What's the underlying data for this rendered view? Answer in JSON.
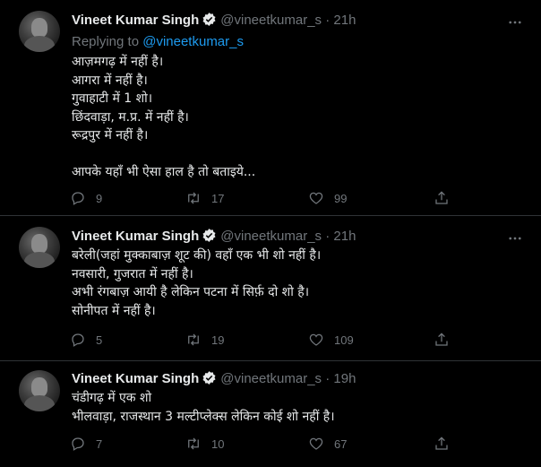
{
  "tweets": [
    {
      "name": "Vineet Kumar Singh",
      "handle": "@vineetkumar_s",
      "dot": "·",
      "time": "21h",
      "replying_prefix": "Replying to ",
      "replying_handle": "@vineetkumar_s",
      "lines": [
        "आज़मगढ़ में नहीं है।",
        "आगरा में नहीं है।",
        "गुवाहाटी में 1 शो।",
        "छिंदवाड़ा, म.प्र. में नहीं है।",
        "रूद्रपुर में नहीं है।",
        "",
        "आपके यहाँ भी ऐसा हाल है तो बताइये..."
      ],
      "replies": "9",
      "retweets": "17",
      "likes": "99"
    },
    {
      "name": "Vineet Kumar Singh",
      "handle": "@vineetkumar_s",
      "dot": "·",
      "time": "21h",
      "lines": [
        "बरेली(जहां मुक्काबाज़ शूट की) वहाँ एक भी शो नहीं है।",
        "नवसारी, गुजरात में नहीं है।",
        "अभी रंगबाज़ आयी है लेकिन पटना में सिर्फ़ दो शो है।",
        "सोनीपत में नहीं है।"
      ],
      "replies": "5",
      "retweets": "19",
      "likes": "109"
    },
    {
      "name": "Vineet Kumar Singh",
      "handle": "@vineetkumar_s",
      "dot": "·",
      "time": "19h",
      "lines": [
        "चंडीगढ़ में एक शो",
        "भीलवाड़ा, राजस्थान 3 मल्टीप्लेक्स लेकिन कोई शो नहीं है।"
      ],
      "replies": "7",
      "retweets": "10",
      "likes": "67"
    }
  ],
  "icons": {
    "reply": "reply-icon",
    "retweet": "retweet-icon",
    "like": "heart-icon",
    "share": "share-icon",
    "more": "more-icon",
    "verified": "verified-badge-icon"
  },
  "colors": {
    "background": "#000000",
    "text": "#e7e9ea",
    "secondary": "#71767b",
    "accent": "#1d9bf0",
    "divider": "#2f3336"
  }
}
